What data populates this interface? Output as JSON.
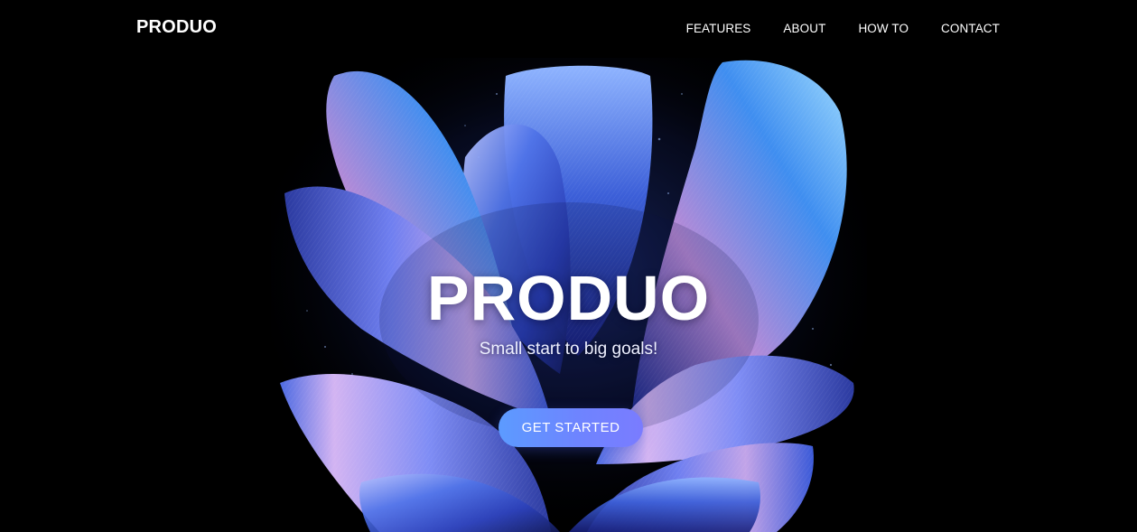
{
  "header": {
    "logo": "PRODUO",
    "nav": [
      {
        "label": "FEATURES"
      },
      {
        "label": "ABOUT"
      },
      {
        "label": "HOW TO"
      },
      {
        "label": "CONTACT"
      }
    ]
  },
  "hero": {
    "title": "PRODUO",
    "subtitle": "Small start to big goals!",
    "cta_label": "GET STARTED"
  },
  "colors": {
    "background": "#000000",
    "accent_start": "#5c9bff",
    "accent_end": "#7a7cff"
  }
}
